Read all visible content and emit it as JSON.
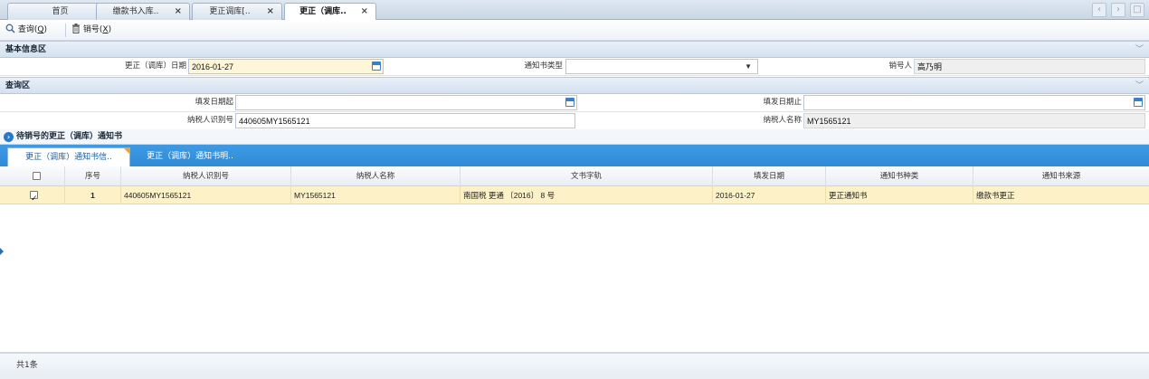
{
  "tabs": [
    {
      "label": "首页",
      "closable": false,
      "active": false
    },
    {
      "label": "缴款书入库..",
      "closable": true,
      "active": false
    },
    {
      "label": "更正调库[..",
      "closable": true,
      "active": false
    },
    {
      "label": "更正（调库..",
      "closable": true,
      "active": true
    }
  ],
  "close_glyph": "×",
  "nav": {
    "prev": "‹",
    "next": "›",
    "max": "□"
  },
  "toolbar": {
    "query_label": "查询(",
    "query_key": "Q",
    "query_end": ")",
    "cancel_label": "销号(",
    "cancel_key": "X",
    "cancel_end": ")"
  },
  "basic_section": {
    "title": "基本信息区",
    "date_label": "更正（调库）日期",
    "date_value": "2016-01-27",
    "notice_type_label": "通知书类型",
    "notice_type_value": "",
    "canceller_label": "销号人",
    "canceller_value": "高乃明"
  },
  "query_section": {
    "title": "查询区",
    "issue_start_label": "填发日期起",
    "issue_start_value": "",
    "issue_end_label": "填发日期止",
    "issue_end_value": "",
    "taxpayer_id_label": "纳税人识别号",
    "taxpayer_id_value": "440605MY1565121",
    "taxpayer_name_label": "纳税人名称",
    "taxpayer_name_value": "MY1565121"
  },
  "grid_title": "待销号的更正（调库）通知书",
  "subtabs": [
    {
      "label": "更正（调库）通知书信..",
      "active": true
    },
    {
      "label": "更正（调库）通知书明..",
      "active": false
    }
  ],
  "grid": {
    "columns": [
      "序号",
      "纳税人识别号",
      "纳税人名称",
      "文书字轨",
      "填发日期",
      "通知书种类",
      "通知书来源"
    ],
    "rows": [
      {
        "checked": true,
        "seq": "1",
        "taxpayer_id": "440605MY1565121",
        "taxpayer_name": "MY1565121",
        "doc_ref": "南国税 更通 〔2016〕 8 号",
        "issue_date": "2016-01-27",
        "notice_kind": "更正通知书",
        "notice_source": "缴款书更正"
      }
    ]
  },
  "footer": {
    "count": "共1条"
  },
  "colors": {
    "accent": "#2f8bd6",
    "selected_row": "#fdf1c8",
    "date_field": "#fdf6d8"
  },
  "icons": {
    "query": "magnifier-icon",
    "cancel": "trash-icon",
    "calendar": "calendar-icon",
    "info": "info-icon"
  }
}
